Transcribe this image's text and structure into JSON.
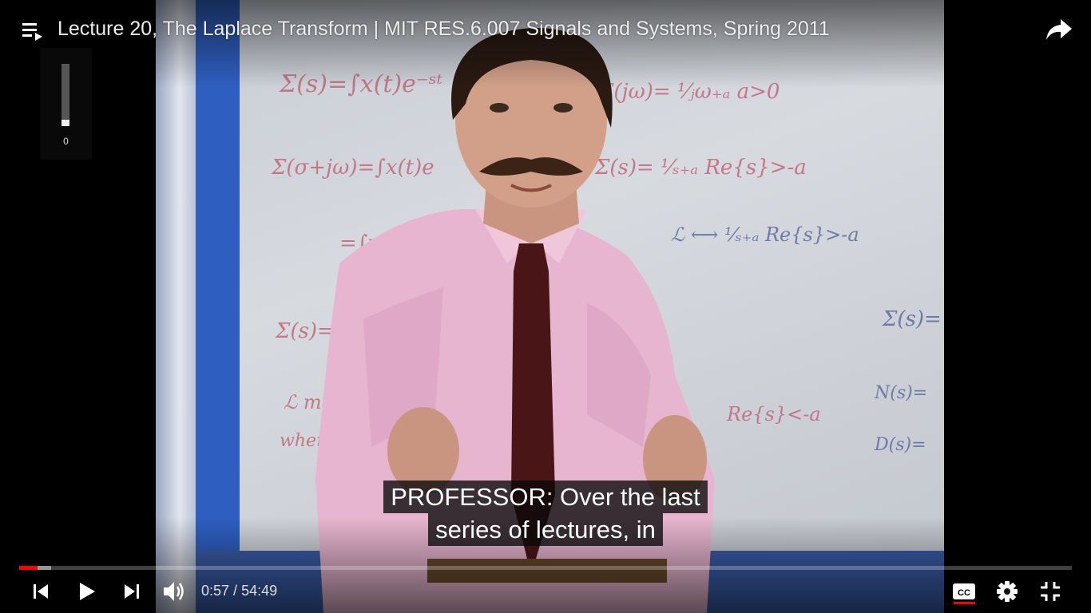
{
  "video": {
    "title": "Lecture 20, The Laplace Transform | MIT RES.6.007 Signals and Systems, Spring 2011",
    "caption_lines": [
      "PROFESSOR: Over the last",
      "series of lectures, in"
    ]
  },
  "volume": {
    "value": "0",
    "level": 0.1
  },
  "player": {
    "current_time": "0:57",
    "separator": " / ",
    "duration": "54:49",
    "played_fraction": 0.0174,
    "buffered_fraction": 0.0303,
    "colors": {
      "accent": "#ff0000",
      "chrome": "#eeeeee"
    }
  },
  "icons": {
    "playlist": "playlist-icon",
    "share": "share-icon",
    "previous": "previous-icon",
    "play": "play-icon",
    "next": "next-icon",
    "volume": "volume-icon",
    "captions": "captions-icon",
    "settings": "settings-icon",
    "exit_fullscreen": "exit-fullscreen-icon"
  }
}
